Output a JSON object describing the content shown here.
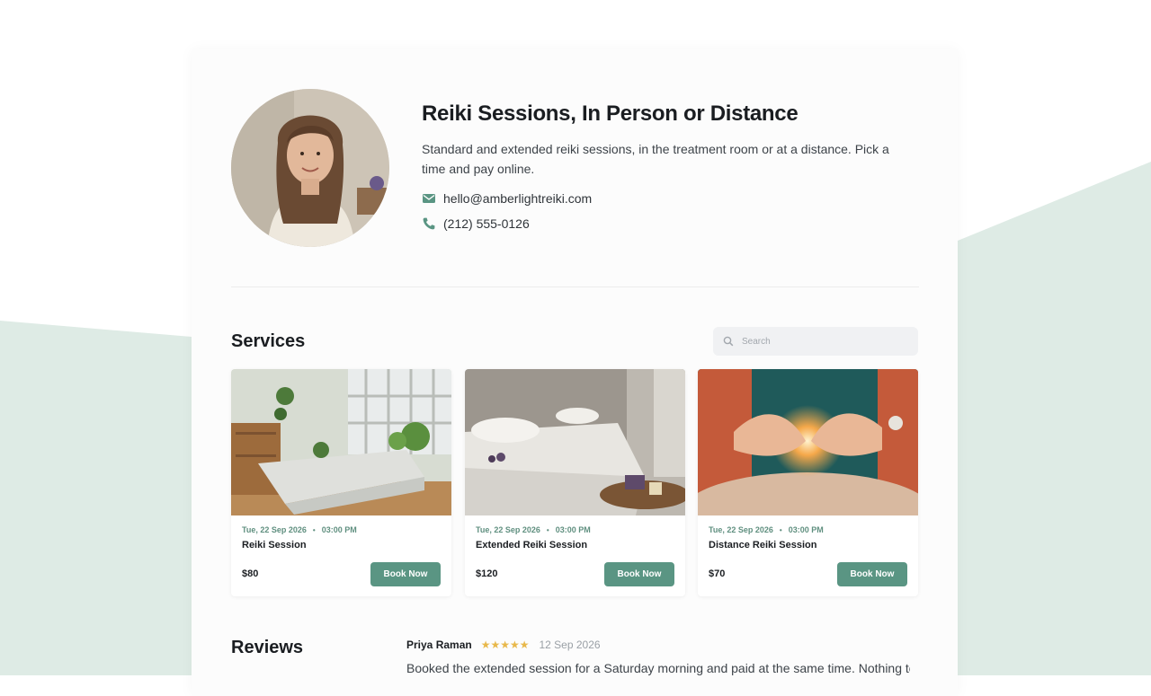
{
  "colors": {
    "accent": "#5a9583",
    "accent_text": "#5f8f7f",
    "background_shape": "#deebe5",
    "star": "#e8b84a"
  },
  "profile": {
    "title": "Reiki Sessions, In Person or Distance",
    "description": "Standard and extended reiki sessions, in the treatment room or at a distance. Pick a time and pay online.",
    "email": "hello@amberlightreiki.com",
    "phone": "(212) 555-0126",
    "email_icon": "mail-icon",
    "phone_icon": "phone-icon"
  },
  "services": {
    "heading": "Services",
    "search_placeholder": "Search",
    "items": [
      {
        "date": "Tue, 22 Sep 2026",
        "time": "03:00 PM",
        "name": "Reiki Session",
        "price": "$80",
        "button": "Book Now"
      },
      {
        "date": "Tue, 22 Sep 2026",
        "time": "03:00 PM",
        "name": "Extended Reiki Session",
        "price": "$120",
        "button": "Book Now"
      },
      {
        "date": "Tue, 22 Sep 2026",
        "time": "03:00 PM",
        "name": "Distance Reiki Session",
        "price": "$70",
        "button": "Book Now"
      }
    ]
  },
  "reviews": {
    "heading": "Reviews",
    "items": [
      {
        "name": "Priya Raman",
        "rating": 5,
        "stars": "★★★★★",
        "date": "12 Sep 2026",
        "text": "Booked the extended session for a Saturday morning and paid at the same time. Nothing to"
      }
    ]
  }
}
